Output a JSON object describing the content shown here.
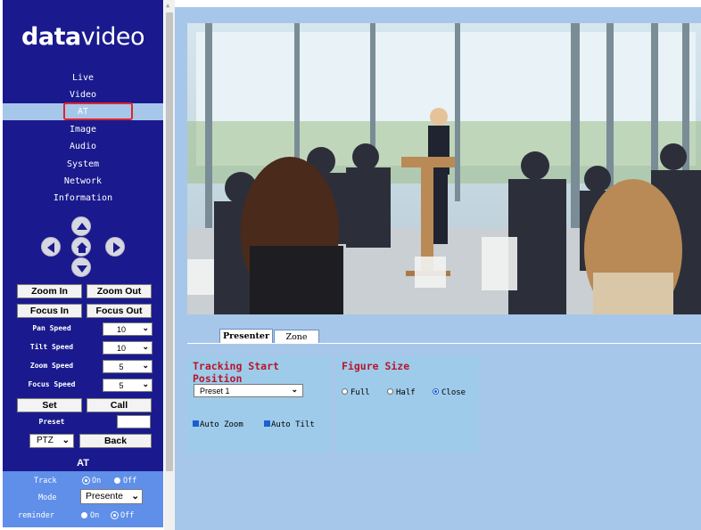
{
  "brand": {
    "logo_bold": "data",
    "logo_light": "video"
  },
  "nav": {
    "items": [
      "Live",
      "Video",
      "AT",
      "Image",
      "Audio",
      "System",
      "Network",
      "Information"
    ],
    "active_index": 2
  },
  "ptz_arrows": [
    "up-arrow-icon",
    "left-arrow-icon",
    "home-icon",
    "right-arrow-icon",
    "down-arrow-icon"
  ],
  "controls": {
    "zoom_in": "Zoom In",
    "zoom_out": "Zoom Out",
    "focus_in": "Focus In",
    "focus_out": "Focus Out",
    "pan_speed_label": "Pan Speed",
    "pan_speed": "10",
    "tilt_speed_label": "Tilt Speed",
    "tilt_speed": "10",
    "zoom_speed_label": "Zoom Speed",
    "zoom_speed": "5",
    "focus_speed_label": "Focus Speed",
    "focus_speed": "5",
    "set": "Set",
    "call": "Call",
    "preset_label": "Preset",
    "preset_value": "",
    "mode_select": "PTZ",
    "back": "Back"
  },
  "at_section": {
    "title": "AT",
    "track_label": "Track",
    "track_on": "On",
    "track_off": "Off",
    "track_value": "On",
    "mode_label": "Mode",
    "mode_value": "Presente",
    "reminder_label": "reminder",
    "reminder_on": "On",
    "reminder_off": "Off",
    "reminder_value": "Off"
  },
  "tabs": {
    "items": [
      "Presenter",
      "Zone"
    ],
    "active_index": 0
  },
  "tracking": {
    "title": "Tracking Start Position",
    "preset_selected": "Preset 1",
    "auto_zoom_label": "Auto Zoom",
    "auto_zoom": true,
    "auto_tilt_label": "Auto Tilt",
    "auto_tilt": true
  },
  "figure_size": {
    "title": "Figure Size",
    "options": [
      "Full",
      "Half",
      "Close"
    ],
    "selected": "Close"
  },
  "colors": {
    "sidebar_bg": "#1a1a8e",
    "main_bg": "#a7c7ea",
    "card_bg": "#9ecbea",
    "card_title": "#b8162a",
    "active_outline": "#e0242b",
    "at_panel": "#5f8fe8"
  }
}
